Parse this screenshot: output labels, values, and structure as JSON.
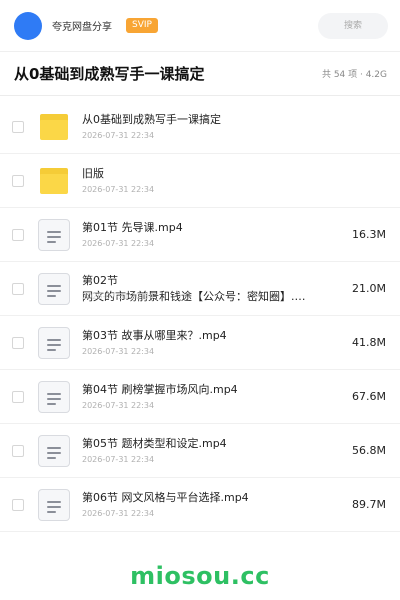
{
  "header": {
    "username": "夸克网盘分享",
    "badge": "SVIP",
    "search_placeholder": "搜索"
  },
  "titlebar": {
    "title": "从0基础到成熟写手一课搞定",
    "summary": "共 54 项 · 4.2G"
  },
  "files": [
    {
      "type": "folder",
      "name": "从0基础到成熟写手一课搞定",
      "date": "2026-07-31 22:34",
      "size": ""
    },
    {
      "type": "folder",
      "name": "旧版",
      "date": "2026-07-31 22:34",
      "size": ""
    },
    {
      "type": "file",
      "name": "第01节 先导课.mp4",
      "date": "2026-07-31 22:34",
      "size": "16.3M"
    },
    {
      "type": "file",
      "name": "第02节",
      "name2": "网文的市场前景和钱途【公众号：密知圈】.…",
      "date": "2026-07-31 22:34",
      "size": "21.0M"
    },
    {
      "type": "file",
      "name": "第03节 故事从哪里来？.mp4",
      "date": "2026-07-31 22:34",
      "size": "41.8M"
    },
    {
      "type": "file",
      "name": "第04节 刷榜掌握市场风向.mp4",
      "date": "2026-07-31 22:34",
      "size": "67.6M"
    },
    {
      "type": "file",
      "name": "第05节 题材类型和设定.mp4",
      "date": "2026-07-31 22:34",
      "size": "56.8M"
    },
    {
      "type": "file",
      "name": "第06节 网文风格与平台选择.mp4",
      "date": "2026-07-31 22:34",
      "size": "89.7M"
    }
  ],
  "watermark": "miosou.cc",
  "colors": {
    "accent": "#2f7bf5",
    "svip": "#f8a534",
    "folder": "#fbd747",
    "watermark": "#2ec063"
  },
  "icons": {
    "folder": "folder-icon",
    "file": "video-file-icon"
  }
}
